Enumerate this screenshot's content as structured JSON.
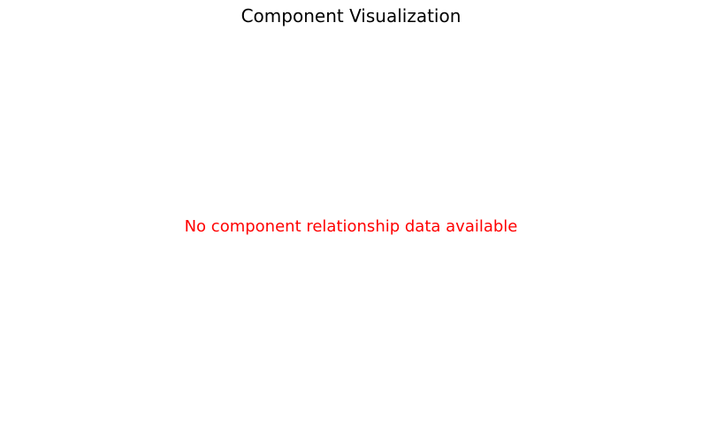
{
  "chart_data": {
    "type": "diagram",
    "title": "Component Visualization",
    "message": "No component relationship data available",
    "message_color": "#ff0000",
    "grid": false
  }
}
